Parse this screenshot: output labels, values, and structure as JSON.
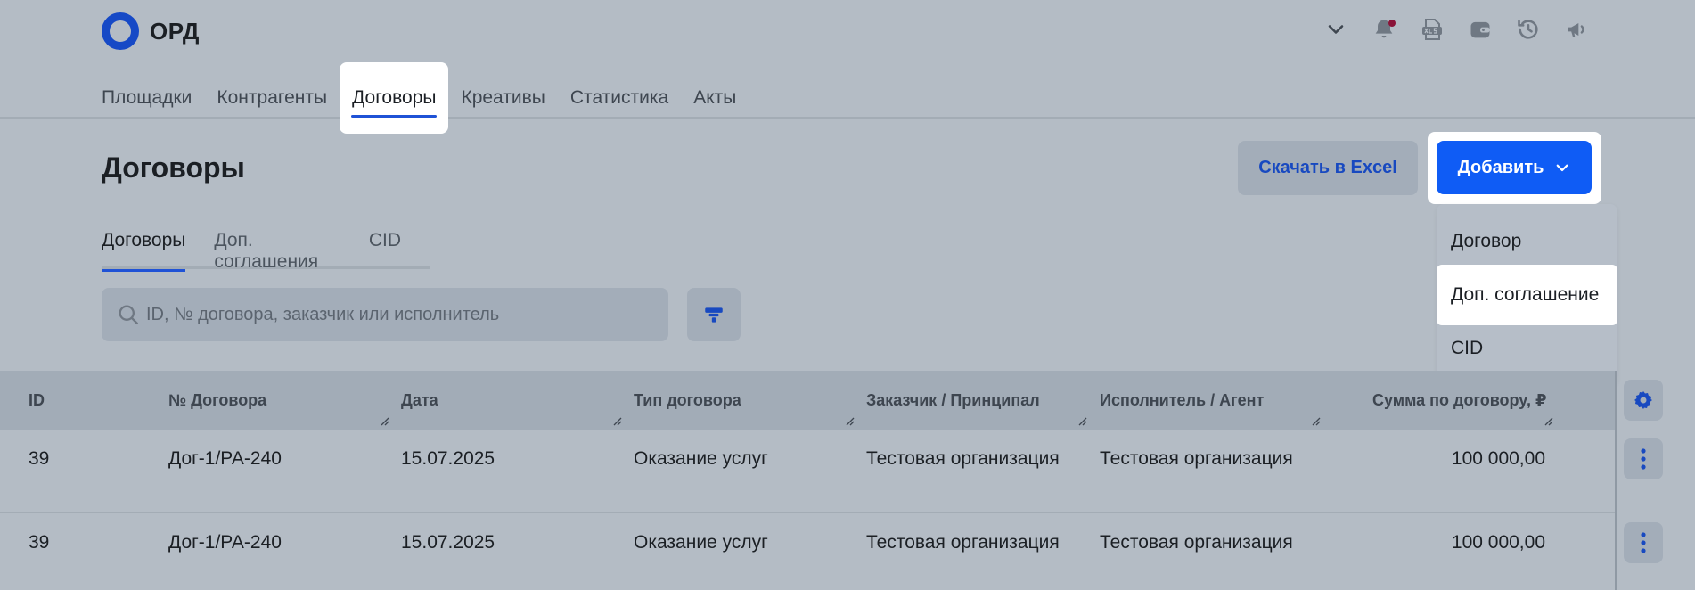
{
  "app": {
    "logo_text": "ОРД"
  },
  "header_icons": [
    "chevron-down-icon",
    "bell-icon",
    "xls-icon",
    "wallet-icon",
    "history-icon",
    "megaphone-icon"
  ],
  "nav": {
    "items": [
      {
        "label": "Площадки"
      },
      {
        "label": "Контрагенты"
      },
      {
        "label": "Договоры",
        "active": true
      },
      {
        "label": "Креативы"
      },
      {
        "label": "Статистика"
      },
      {
        "label": "Акты"
      }
    ]
  },
  "page": {
    "title": "Договоры",
    "excel_label": "Скачать в Excel",
    "add_label": "Добавить"
  },
  "dropdown": {
    "items": [
      {
        "label": "Договор"
      },
      {
        "label": "Доп. соглашение",
        "highlighted": true
      },
      {
        "label": "CID"
      }
    ]
  },
  "subtabs": {
    "items": [
      {
        "label": "Договоры",
        "active": true
      },
      {
        "label": "Доп. соглашения"
      },
      {
        "label": "CID"
      }
    ]
  },
  "search": {
    "placeholder": "ID, № договора, заказчик или исполнитель",
    "value": ""
  },
  "table": {
    "columns": [
      "ID",
      "№ Договора",
      "Дата",
      "Тип договора",
      "Заказчик / Принципал",
      "Исполнитель / Агент",
      "Сумма по договору, ₽"
    ],
    "rows": [
      [
        "39",
        "Дог-1/РА-240",
        "15.07.2025",
        "Оказание услуг",
        "Тестовая организация",
        "Тестовая организация",
        "100 000,00"
      ],
      [
        "39",
        "Дог-1/РА-240",
        "15.07.2025",
        "Оказание услуг",
        "Тестовая организация",
        "Тестовая организация",
        "100 000,00"
      ]
    ]
  },
  "colors": {
    "background": "#b4bcc5",
    "accent": "#0f5cf5",
    "brand": "#1649c6",
    "notification_dot": "#8a1338"
  }
}
